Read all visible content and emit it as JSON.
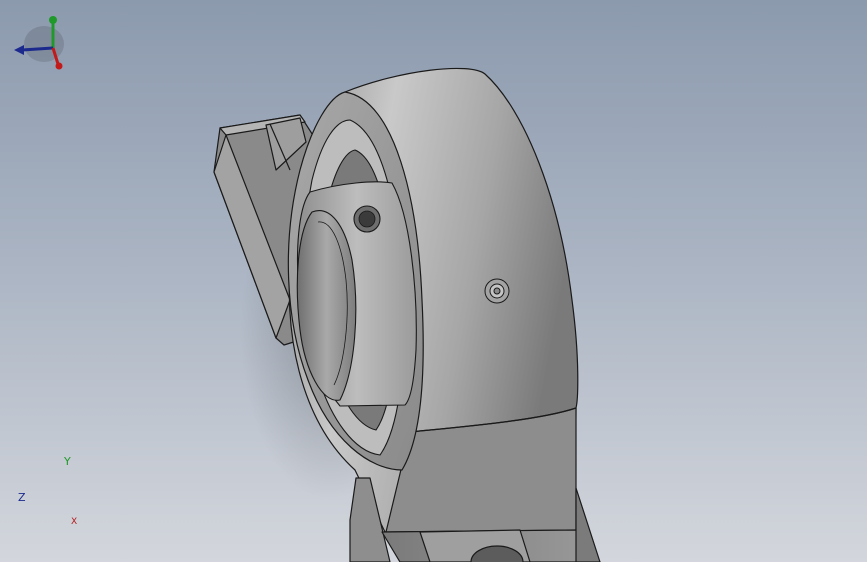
{
  "view": {
    "background_top": "#8c9aae",
    "background_bottom": "#d3d6dc",
    "part_color": "#9a9a9a",
    "edge_color": "#1a1a1a"
  },
  "triad": {
    "x_label": "X",
    "y_label": "Y",
    "z_label": "Z",
    "x_color": "#c21a1a",
    "y_color": "#1f9a2a",
    "z_color": "#1b2a8c"
  }
}
